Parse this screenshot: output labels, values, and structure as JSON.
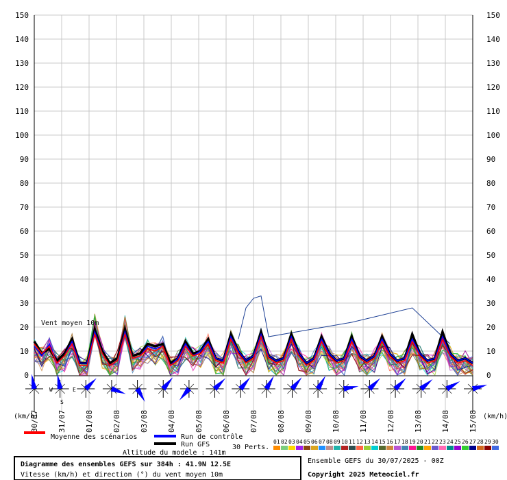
{
  "chart_data": {
    "type": "line",
    "title": "Diagramme des ensembles GEFS sur 384h : 41.9N 12.5E",
    "subtitle": "Vitesse (km/h) et direction (°) du vent moyen 10m",
    "ylabel": "(km/h)",
    "ylim": [
      0,
      150
    ],
    "yticks": [
      0,
      10,
      20,
      30,
      40,
      50,
      60,
      70,
      80,
      90,
      100,
      110,
      120,
      130,
      140,
      150
    ],
    "grid": true,
    "x_dates": [
      "30/07",
      "31/07",
      "01/08",
      "02/08",
      "03/08",
      "04/08",
      "05/08",
      "06/08",
      "07/08",
      "08/08",
      "09/08",
      "10/08",
      "11/08",
      "12/08",
      "13/08",
      "14/08",
      "15/08"
    ],
    "inner_label": "Vent moyen 10m",
    "series": [
      {
        "name": "Moyenne des scénarios",
        "color": "#ff0000",
        "values": [
          13,
          9,
          12,
          5,
          8,
          13,
          4,
          4,
          17,
          9,
          4,
          6,
          17,
          7,
          8,
          11,
          10,
          12,
          4,
          6,
          12,
          8,
          9,
          13,
          6,
          5,
          15,
          9,
          5,
          7,
          16,
          7,
          5,
          6,
          15,
          8,
          4,
          6,
          14,
          8,
          5,
          6,
          14,
          7,
          5,
          7,
          14,
          8,
          5,
          6,
          14,
          8,
          5,
          6,
          15,
          8,
          5,
          6,
          4
        ]
      },
      {
        "name": "Run de contrôle",
        "color": "#0000ff",
        "values": [
          12,
          8,
          13,
          5,
          8,
          14,
          5,
          5,
          18,
          9,
          4,
          6,
          18,
          7,
          8,
          12,
          11,
          12,
          4,
          7,
          13,
          8,
          10,
          14,
          7,
          6,
          16,
          10,
          6,
          8,
          17,
          8,
          6,
          7,
          16,
          9,
          5,
          7,
          15,
          9,
          6,
          7,
          15,
          8,
          6,
          8,
          15,
          9,
          6,
          7,
          15,
          9,
          6,
          7,
          16,
          9,
          6,
          7,
          5
        ]
      },
      {
        "name": "Run GFS",
        "color": "#000000",
        "values": [
          14,
          9,
          11,
          6,
          9,
          15,
          5,
          5,
          19,
          10,
          5,
          7,
          19,
          8,
          9,
          13,
          12,
          13,
          5,
          7,
          14,
          9,
          10,
          15,
          7,
          6,
          17,
          10,
          6,
          8,
          18,
          8,
          6,
          7,
          17,
          9,
          5,
          7,
          16,
          9,
          6,
          7,
          16,
          8,
          6,
          8,
          16,
          9,
          6,
          7,
          17,
          9,
          6,
          7,
          18,
          9,
          6,
          7,
          5
        ]
      }
    ],
    "ensemble_line": [
      10,
      7,
      11,
      4,
      6,
      12,
      3,
      3,
      21,
      8,
      3,
      5,
      20,
      6,
      7,
      10,
      9,
      11,
      3,
      5,
      11,
      7,
      8,
      12,
      5,
      4,
      14,
      8,
      4,
      6,
      15,
      6,
      4,
      5,
      14,
      7,
      3,
      5,
      13,
      7,
      4,
      5,
      13,
      6,
      4,
      6,
      13,
      7,
      4,
      5,
      13,
      7,
      4,
      5,
      14,
      7,
      4,
      5,
      3
    ],
    "control_spike": [
      {
        "index": 27,
        "value": 15
      },
      {
        "index": 28,
        "value": 28
      },
      {
        "index": 29,
        "value": 32
      },
      {
        "index": 30,
        "value": 33
      },
      {
        "index": 31,
        "value": 16
      },
      {
        "index": 42,
        "value": 22
      },
      {
        "index": 50,
        "value": 28
      },
      {
        "index": 55,
        "value": 13
      }
    ],
    "wind_barbs_dir_deg": [
      350,
      350,
      45,
      110,
      150,
      40,
      220,
      45,
      40,
      30,
      40,
      30,
      80,
      45,
      45,
      50,
      60,
      75
    ],
    "perturbations_label": "30 Perts.",
    "perturbation_ids": [
      "01",
      "02",
      "03",
      "04",
      "05",
      "06",
      "07",
      "08",
      "09",
      "10",
      "11",
      "12",
      "13",
      "14",
      "15",
      "16",
      "17",
      "18",
      "19",
      "20",
      "21",
      "22",
      "23",
      "24",
      "25",
      "26",
      "27",
      "28",
      "29",
      "30"
    ],
    "perturbation_colors": [
      "#ff8c00",
      "#7ccd7c",
      "#ffd700",
      "#a020f0",
      "#8b4513",
      "#daa520",
      "#1e90ff",
      "#bc8f8f",
      "#20b2aa",
      "#b22222",
      "#2f4f4f",
      "#ff6347",
      "#9acd32",
      "#00ced1",
      "#556b2f",
      "#cd853f",
      "#ba55d3",
      "#4682b4",
      "#ff1493",
      "#228b22",
      "#ffa500",
      "#6a5acd",
      "#ff69b4",
      "#008b8b",
      "#9400d3",
      "#32cd32",
      "#00008b",
      "#d2691e",
      "#8b0000",
      "#4169e1"
    ]
  },
  "footer": {
    "altitude": "Altitude du modele : 141m",
    "ensemble_info": "Ensemble GEFS du 30/07/2025 - 00Z",
    "copyright": "Copyright 2025 Meteociel.fr",
    "compass": {
      "w": "W",
      "e": "E",
      "s": "S"
    }
  }
}
